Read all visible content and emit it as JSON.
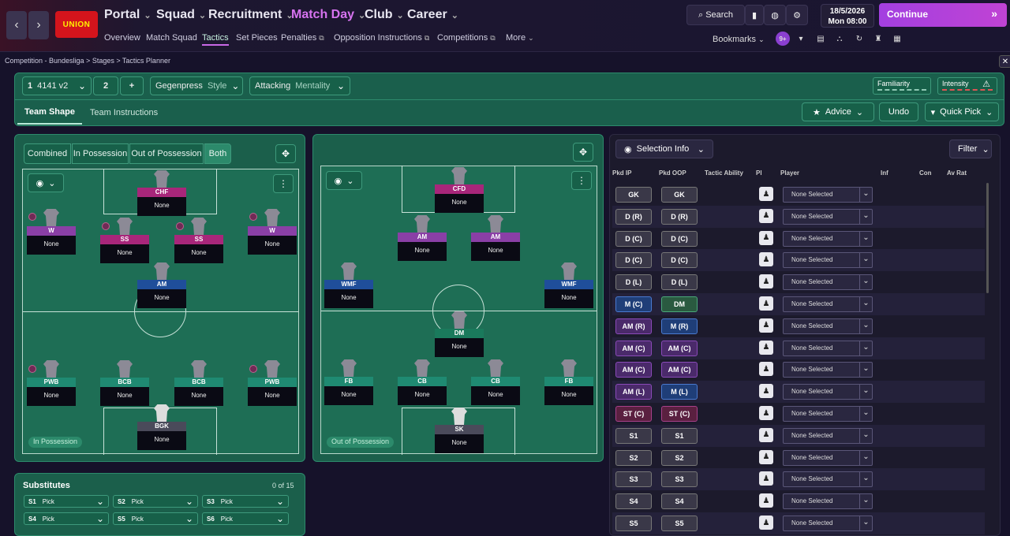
{
  "nav": {
    "back": "‹",
    "forward": "›",
    "logo_text": "UNION",
    "main": [
      {
        "label": "Portal"
      },
      {
        "label": "Squad"
      },
      {
        "label": "Recruitment"
      },
      {
        "label": "Match Day"
      },
      {
        "label": "Club"
      },
      {
        "label": "Career"
      }
    ],
    "sub": [
      "Overview",
      "Match Squad",
      "Tactics",
      "Set Pieces",
      "Penalties",
      "Opposition Instructions",
      "Competitions",
      "More"
    ],
    "search_label": "Search",
    "bookmarks_label": "Bookmarks",
    "badge": "9+",
    "date": "18/5/2026",
    "time": "Mon  08:00",
    "continue_label": "Continue"
  },
  "breadcrumb": "Competition - Bundesliga  >  Stages  >  Tactics Planner",
  "tactic": {
    "slot1_num": "1",
    "slot1_name": "4141 v2",
    "slot2_num": "2",
    "add": "+",
    "style_value": "Gegenpress",
    "style_label": "Style",
    "mentality_value": "Attacking",
    "mentality_label": "Mentality",
    "familiarity_label": "Familiarity",
    "intensity_label": "Intensity",
    "tabs": [
      "Team Shape",
      "Team Instructions"
    ],
    "advice_label": "Advice",
    "undo_label": "Undo",
    "quickpick_label": "Quick Pick"
  },
  "view_toggle": [
    "Combined",
    "In Possession",
    "Out of Possession",
    "Both"
  ],
  "in_possession_label": "In Possession",
  "out_possession_label": "Out of Possession",
  "in_players": [
    {
      "role": "CHF",
      "name": "None"
    },
    {
      "role": "W",
      "name": "None"
    },
    {
      "role": "SS",
      "name": "None"
    },
    {
      "role": "SS",
      "name": "None"
    },
    {
      "role": "W",
      "name": "None"
    },
    {
      "role": "AM",
      "name": "None"
    },
    {
      "role": "PWB",
      "name": "None"
    },
    {
      "role": "BCB",
      "name": "None"
    },
    {
      "role": "BCB",
      "name": "None"
    },
    {
      "role": "PWB",
      "name": "None"
    },
    {
      "role": "BGK",
      "name": "None"
    }
  ],
  "out_players": [
    {
      "role": "CFD",
      "name": "None"
    },
    {
      "role": "AM",
      "name": "None"
    },
    {
      "role": "AM",
      "name": "None"
    },
    {
      "role": "WMF",
      "name": "None"
    },
    {
      "role": "WMF",
      "name": "None"
    },
    {
      "role": "DM",
      "name": "None"
    },
    {
      "role": "FB",
      "name": "None"
    },
    {
      "role": "CB",
      "name": "None"
    },
    {
      "role": "CB",
      "name": "None"
    },
    {
      "role": "FB",
      "name": "None"
    },
    {
      "role": "SK",
      "name": "None"
    }
  ],
  "subs": {
    "title": "Substitutes",
    "count": "0 of 15",
    "slots": [
      {
        "id": "S1",
        "value": "Pick"
      },
      {
        "id": "S2",
        "value": "Pick"
      },
      {
        "id": "S3",
        "value": "Pick"
      },
      {
        "id": "S4",
        "value": "Pick"
      },
      {
        "id": "S5",
        "value": "Pick"
      },
      {
        "id": "S6",
        "value": "Pick"
      }
    ]
  },
  "selection": {
    "info_label": "Selection Info",
    "filter_label": "Filter",
    "headers": [
      "Pkd IP",
      "Pkd OOP",
      "Tactic Ability",
      "Pl",
      "Player",
      "Inf",
      "Con",
      "Av Rat"
    ],
    "rows": [
      {
        "ip": "GK",
        "oop": "GK",
        "ipc": "grey",
        "oopc": "grey",
        "player": "None Selected"
      },
      {
        "ip": "D (R)",
        "oop": "D (R)",
        "ipc": "grey",
        "oopc": "grey",
        "player": "None Selected"
      },
      {
        "ip": "D (C)",
        "oop": "D (C)",
        "ipc": "grey",
        "oopc": "grey",
        "player": "None Selected"
      },
      {
        "ip": "D (C)",
        "oop": "D (C)",
        "ipc": "grey",
        "oopc": "grey",
        "player": "None Selected"
      },
      {
        "ip": "D (L)",
        "oop": "D (L)",
        "ipc": "grey",
        "oopc": "grey",
        "player": "None Selected"
      },
      {
        "ip": "M (C)",
        "oop": "DM",
        "ipc": "blue",
        "oopc": "green",
        "player": "None Selected"
      },
      {
        "ip": "AM (R)",
        "oop": "M (R)",
        "ipc": "purple",
        "oopc": "blue",
        "player": "None Selected"
      },
      {
        "ip": "AM (C)",
        "oop": "AM (C)",
        "ipc": "purple",
        "oopc": "purple",
        "player": "None Selected"
      },
      {
        "ip": "AM (C)",
        "oop": "AM (C)",
        "ipc": "purple",
        "oopc": "purple",
        "player": "None Selected"
      },
      {
        "ip": "AM (L)",
        "oop": "M (L)",
        "ipc": "purple",
        "oopc": "blue",
        "player": "None Selected"
      },
      {
        "ip": "ST (C)",
        "oop": "ST (C)",
        "ipc": "pink",
        "oopc": "pink",
        "player": "None Selected"
      },
      {
        "ip": "S1",
        "oop": "S1",
        "ipc": "grey",
        "oopc": "grey",
        "player": "None Selected"
      },
      {
        "ip": "S2",
        "oop": "S2",
        "ipc": "grey",
        "oopc": "grey",
        "player": "None Selected"
      },
      {
        "ip": "S3",
        "oop": "S3",
        "ipc": "grey",
        "oopc": "grey",
        "player": "None Selected"
      },
      {
        "ip": "S4",
        "oop": "S4",
        "ipc": "grey",
        "oopc": "grey",
        "player": "None Selected"
      },
      {
        "ip": "S5",
        "oop": "S5",
        "ipc": "grey",
        "oopc": "grey",
        "player": "None Selected"
      }
    ]
  }
}
